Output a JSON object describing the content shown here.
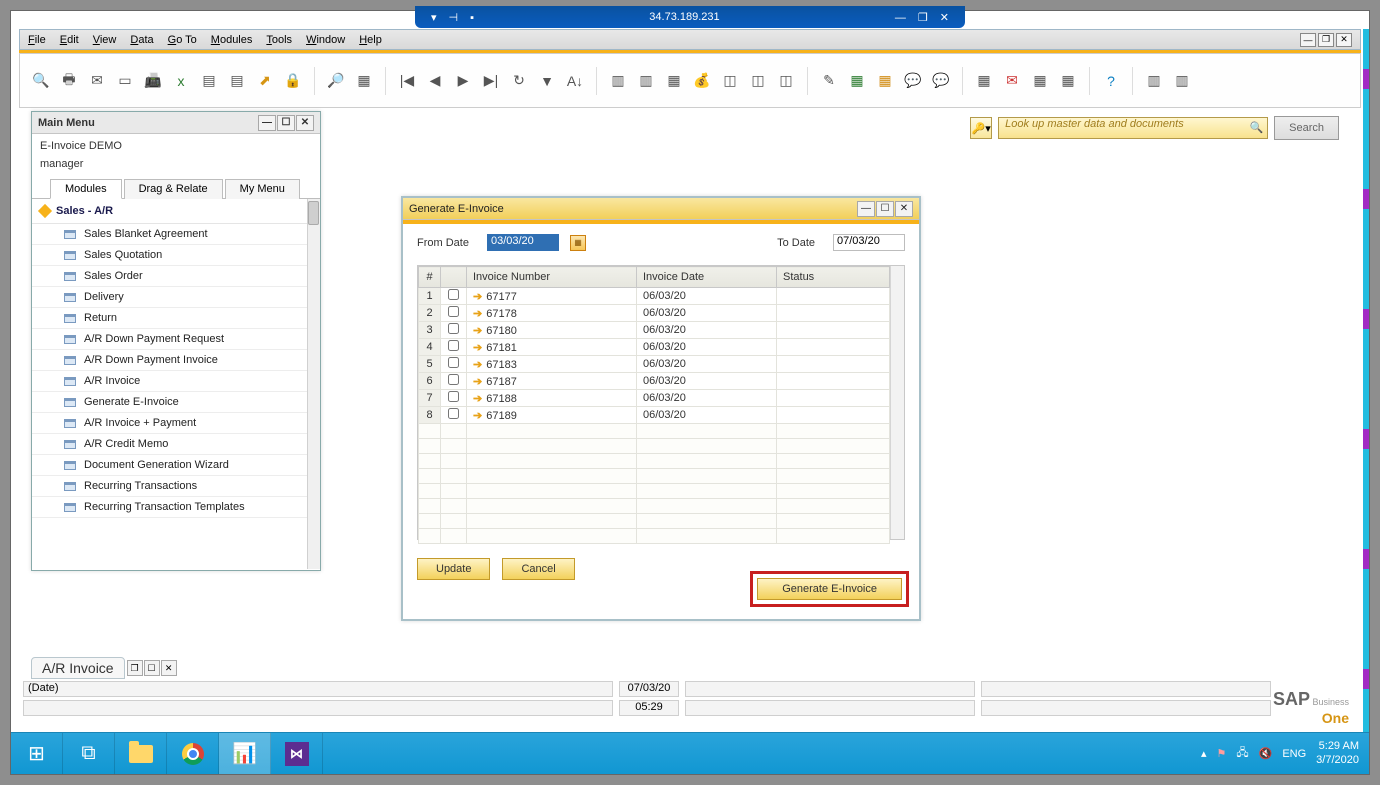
{
  "remote": {
    "ip": "34.73.189.231"
  },
  "menubar": [
    "File",
    "Edit",
    "View",
    "Data",
    "Go To",
    "Modules",
    "Tools",
    "Window",
    "Help"
  ],
  "search": {
    "placeholder": "Look up master data and documents",
    "button": "Search"
  },
  "mainMenu": {
    "title": "Main Menu",
    "company": "E-Invoice DEMO",
    "user": "manager",
    "tabs": [
      "Modules",
      "Drag & Relate",
      "My Menu"
    ],
    "activeTab": 0,
    "sectionTitle": "Sales - A/R",
    "items": [
      "Sales Blanket Agreement",
      "Sales Quotation",
      "Sales Order",
      "Delivery",
      "Return",
      "A/R Down Payment Request",
      "A/R Down Payment Invoice",
      "A/R Invoice",
      "Generate E-Invoice",
      "A/R Invoice + Payment",
      "A/R Credit Memo",
      "Document Generation Wizard",
      "Recurring Transactions",
      "Recurring Transaction Templates"
    ]
  },
  "dialog": {
    "title": "Generate E-Invoice",
    "fromLabel": "From Date",
    "toLabel": "To Date",
    "fromDate": "03/03/20",
    "toDate": "07/03/20",
    "columns": {
      "num": "#",
      "invoice": "Invoice Number",
      "date": "Invoice Date",
      "status": "Status"
    },
    "rows": [
      {
        "n": "1",
        "inv": "67177",
        "date": "06/03/20"
      },
      {
        "n": "2",
        "inv": "67178",
        "date": "06/03/20"
      },
      {
        "n": "3",
        "inv": "67180",
        "date": "06/03/20"
      },
      {
        "n": "4",
        "inv": "67181",
        "date": "06/03/20"
      },
      {
        "n": "5",
        "inv": "67183",
        "date": "06/03/20"
      },
      {
        "n": "6",
        "inv": "67187",
        "date": "06/03/20"
      },
      {
        "n": "7",
        "inv": "67188",
        "date": "06/03/20"
      },
      {
        "n": "8",
        "inv": "67189",
        "date": "06/03/20"
      }
    ],
    "buttons": {
      "update": "Update",
      "cancel": "Cancel",
      "generate": "Generate E-Invoice"
    }
  },
  "dockedWindow": {
    "title": "A/R Invoice"
  },
  "statusBar": {
    "label": "(Date)",
    "date": "07/03/20",
    "time": "05:29"
  },
  "taskbar": {
    "lang": "ENG",
    "clockTime": "5:29 AM",
    "clockDate": "3/7/2020"
  }
}
